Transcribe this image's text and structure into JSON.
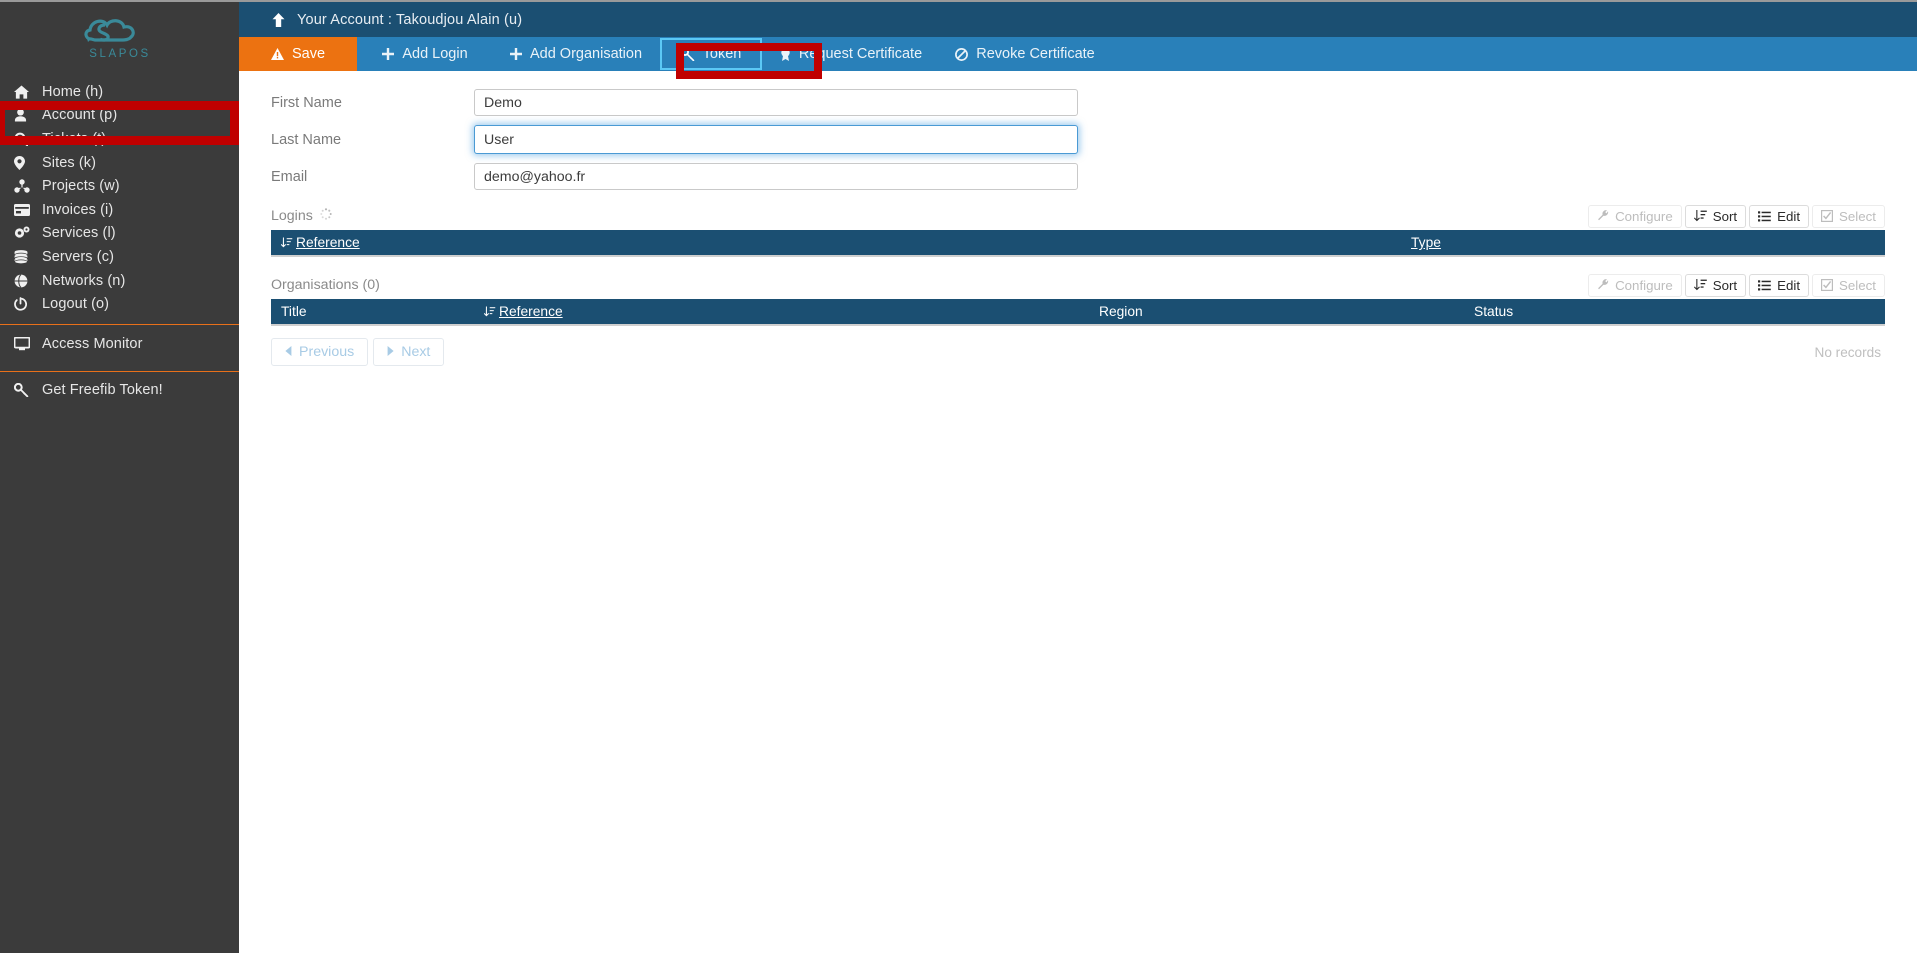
{
  "brand": {
    "name": "SLAPOS",
    "logo_color": "#3a8a99",
    "accent": "#e8701a"
  },
  "sidebar": {
    "items": [
      {
        "label": "Home (h)",
        "icon": "home-icon"
      },
      {
        "label": "Account (p)",
        "icon": "user-icon"
      },
      {
        "label": "Tickets (t)",
        "icon": "search-icon"
      },
      {
        "label": "Sites (k)",
        "icon": "map-pin-icon"
      },
      {
        "label": "Projects (w)",
        "icon": "projects-icon"
      },
      {
        "label": "Invoices (i)",
        "icon": "credit-card-icon"
      },
      {
        "label": "Services (l)",
        "icon": "gears-icon"
      },
      {
        "label": "Servers (c)",
        "icon": "database-icon"
      },
      {
        "label": "Networks (n)",
        "icon": "globe-icon"
      },
      {
        "label": "Logout (o)",
        "icon": "power-icon"
      }
    ],
    "access_monitor": {
      "label": "Access Monitor",
      "icon": "monitor-icon"
    },
    "freefib": {
      "label": "Get Freefib Token!",
      "icon": "key-icon"
    }
  },
  "header": {
    "breadcrumb": "Your Account : Takoudjou Alain (u)",
    "up_icon": "arrow-up-icon"
  },
  "tabs": [
    {
      "label": "Save",
      "icon": "warning-icon",
      "state": "primary"
    },
    {
      "label": "Add Login",
      "icon": "plus-icon",
      "state": "normal"
    },
    {
      "label": "Add Organisation",
      "icon": "plus-icon",
      "state": "normal"
    },
    {
      "label": "Token",
      "icon": "key-icon",
      "state": "focused"
    },
    {
      "label": "Request Certificate",
      "icon": "certificate-icon",
      "state": "normal"
    },
    {
      "label": "Revoke Certificate",
      "icon": "ban-icon",
      "state": "normal"
    }
  ],
  "form": {
    "fields": [
      {
        "label": "First Name",
        "value": "Demo",
        "focused": false
      },
      {
        "label": "Last Name",
        "value": "User",
        "focused": true
      },
      {
        "label": "Email",
        "value": "demo@yahoo.fr",
        "focused": false
      }
    ]
  },
  "logins": {
    "title": "Logins",
    "spinner_icon": "loading-spinner-icon",
    "toolbar": [
      {
        "label": "Configure",
        "icon": "wrench-icon",
        "disabled": true
      },
      {
        "label": "Sort",
        "icon": "sort-icon",
        "disabled": false
      },
      {
        "label": "Edit",
        "icon": "list-icon",
        "disabled": false
      },
      {
        "label": "Select",
        "icon": "checkbox-icon",
        "disabled": true
      }
    ],
    "columns": [
      {
        "label": "Reference",
        "sortable": true,
        "sort_icon": "sort-desc-icon"
      },
      {
        "label": "Type",
        "sortable": true,
        "sort_icon": ""
      }
    ]
  },
  "organisations": {
    "title": "Organisations (0)",
    "toolbar": [
      {
        "label": "Configure",
        "icon": "wrench-icon",
        "disabled": true
      },
      {
        "label": "Sort",
        "icon": "sort-icon",
        "disabled": false
      },
      {
        "label": "Edit",
        "icon": "list-icon",
        "disabled": false
      },
      {
        "label": "Select",
        "icon": "checkbox-icon",
        "disabled": true
      }
    ],
    "columns": [
      {
        "label": "Title",
        "sortable": false,
        "sort_icon": ""
      },
      {
        "label": "Reference",
        "sortable": true,
        "sort_icon": "sort-desc-icon"
      },
      {
        "label": "Region",
        "sortable": false,
        "sort_icon": ""
      },
      {
        "label": "Status",
        "sortable": false,
        "sort_icon": ""
      }
    ],
    "pager": {
      "previous": "Previous",
      "next": "Next",
      "prev_icon": "caret-left-icon",
      "next_icon": "caret-right-icon"
    },
    "empty_text": "No records"
  },
  "annotations": {
    "account_box_color": "#c00000",
    "token_box_color": "#c00000"
  }
}
